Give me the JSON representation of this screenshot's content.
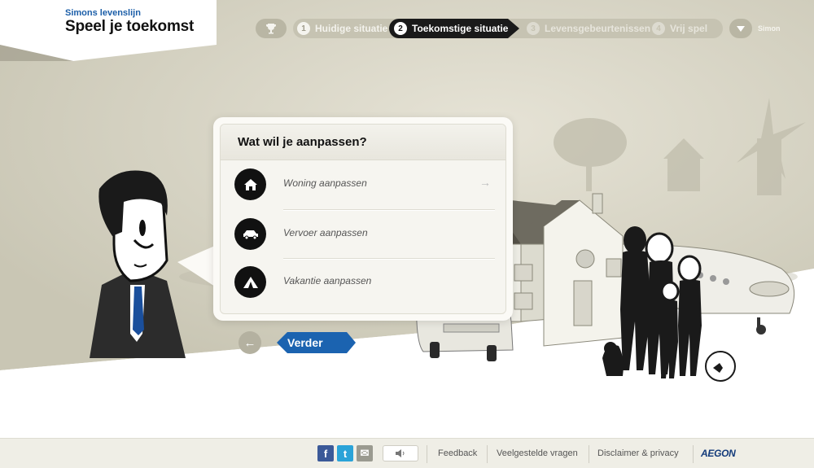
{
  "brand": {
    "subtitle": "Simons levenslijn",
    "title": "Speel je toekomst"
  },
  "nav": {
    "steps": [
      {
        "number": "1",
        "label": "Huidige situatie",
        "state": "done"
      },
      {
        "number": "2",
        "label": "Toekomstige situatie",
        "state": "active"
      },
      {
        "number": "3",
        "label": "Levensgebeurtenissen",
        "state": "disabled"
      },
      {
        "number": "4",
        "label": "Vrij spel",
        "state": "disabled"
      }
    ],
    "trophy_icon": "trophy-icon",
    "user_name": "Simon"
  },
  "panel": {
    "title": "Wat wil je aanpassen?",
    "options": [
      {
        "label": "Woning aanpassen",
        "icon": "house-icon"
      },
      {
        "label": "Vervoer aanpassen",
        "icon": "car-icon"
      },
      {
        "label": "Vakantie aanpassen",
        "icon": "tent-icon"
      }
    ]
  },
  "actions": {
    "next_label": "Verder",
    "back_icon": "arrow-left-icon"
  },
  "footer": {
    "social": [
      "f",
      "t",
      "✉"
    ],
    "links": [
      "Feedback",
      "Veelgestelde vragen",
      "Disclaimer & privacy"
    ],
    "logo": "AEGON"
  },
  "colors": {
    "accent": "#1b63b0",
    "brand": "#1b5ea8",
    "scene": "#d6d3c3",
    "active_step": "#1a1a1a"
  }
}
